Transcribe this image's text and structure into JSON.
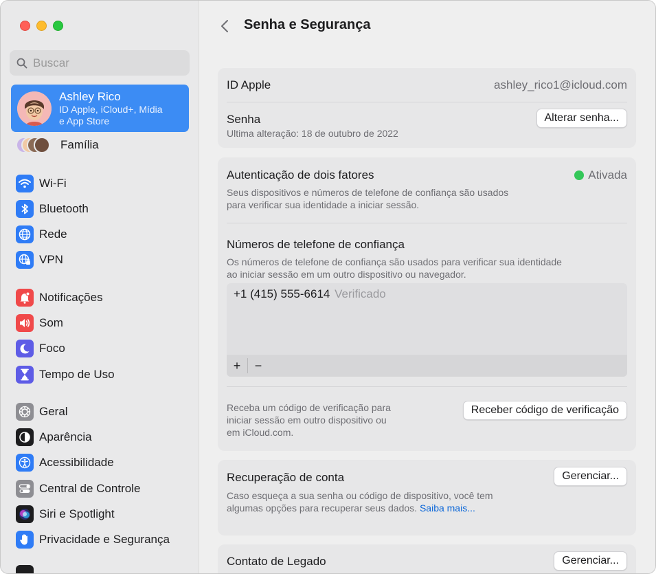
{
  "sidebar": {
    "search_placeholder": "Buscar",
    "user": {
      "name": "Ashley Rico",
      "subtitle_line1": "ID Apple, iCloud+, Mídia",
      "subtitle_line2": "e App Store"
    },
    "family_label": "Família",
    "items": [
      {
        "label": "Wi-Fi",
        "icon": "wifi-icon",
        "color": "#2f7cf6"
      },
      {
        "label": "Bluetooth",
        "icon": "bluetooth-icon",
        "color": "#2f7cf6"
      },
      {
        "label": "Rede",
        "icon": "globe-icon",
        "color": "#2f7cf6"
      },
      {
        "label": "VPN",
        "icon": "vpn-globe-icon",
        "color": "#2f7cf6"
      },
      {
        "label": "Notificações",
        "icon": "bell-icon",
        "color": "#f0494a"
      },
      {
        "label": "Som",
        "icon": "speaker-icon",
        "color": "#f0494a"
      },
      {
        "label": "Foco",
        "icon": "moon-icon",
        "color": "#5e5ce6"
      },
      {
        "label": "Tempo de Uso",
        "icon": "hourglass-icon",
        "color": "#5e5ce6"
      },
      {
        "label": "Geral",
        "icon": "gear-icon",
        "color": "#8e8e93"
      },
      {
        "label": "Aparência",
        "icon": "appearance-icon",
        "color": "#1d1d1f"
      },
      {
        "label": "Acessibilidade",
        "icon": "accessibility-icon",
        "color": "#2f7cf6"
      },
      {
        "label": "Central de Controle",
        "icon": "toggles-icon",
        "color": "#8e8e93"
      },
      {
        "label": "Siri e Spotlight",
        "icon": "siri-icon",
        "color": "#1d1d1f"
      },
      {
        "label": "Privacidade e Segurança",
        "icon": "hand-icon",
        "color": "#2f7cf6"
      }
    ]
  },
  "main": {
    "title": "Senha e Segurança",
    "apple_id": {
      "label": "ID Apple",
      "value": "ashley_rico1@icloud.com"
    },
    "password": {
      "label": "Senha",
      "last_changed": "Ultima alteração: 18 de outubro de 2022",
      "button": "Alterar senha..."
    },
    "two_factor": {
      "label": "Autenticação de dois fatores",
      "status": "Ativada",
      "status_color": "#34c759",
      "desc_line1": "Seus dispositivos e números de telefone de confiança são usados",
      "desc_line2": "para verificar sua identidade a iniciar sessão."
    },
    "trusted_numbers": {
      "label": "Números de telefone de confiança",
      "desc_line1": "Os números de telefone de confiança são usados para verificar sua identidade",
      "desc_line2": "ao iniciar sessão em um outro dispositivo ou navegador.",
      "phone": "+1 (415) 555-6614",
      "phone_status": "Verificado",
      "add": "+",
      "remove": "−"
    },
    "verification": {
      "desc_line1": "Receba um código de verificação para",
      "desc_line2": "iniciar sessão em outro dispositivo ou",
      "desc_line3": "em iCloud.com.",
      "button": "Receber código de verificação"
    },
    "recovery": {
      "label": "Recuperação de conta",
      "desc_line1": "Caso esqueça a sua senha ou código de dispositivo, você tem",
      "desc_line2": "algumas opções para recuperar seus dados.",
      "link": "Saiba mais...",
      "button": "Gerenciar..."
    },
    "legacy": {
      "label": "Contato de Legado",
      "button": "Gerenciar..."
    }
  }
}
